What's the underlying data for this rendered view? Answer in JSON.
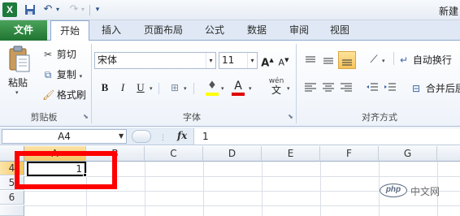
{
  "app": {
    "logo_letter": "X",
    "title": "新建"
  },
  "qat": {
    "save_icon": "save-icon",
    "undo_icon": "undo-icon",
    "redo_icon": "redo-icon",
    "customize_icon": "customize-qat-icon"
  },
  "tabs": [
    {
      "label": "文件"
    },
    {
      "label": "开始"
    },
    {
      "label": "插入"
    },
    {
      "label": "页面布局"
    },
    {
      "label": "公式"
    },
    {
      "label": "数据"
    },
    {
      "label": "审阅"
    },
    {
      "label": "视图"
    }
  ],
  "clipboard": {
    "paste_label": "粘贴",
    "cut_label": "剪切",
    "copy_label": "复制",
    "format_painter_label": "格式刷",
    "group_label": "剪贴板"
  },
  "font": {
    "font_name": "宋体",
    "font_size": "11",
    "bold_label": "B",
    "italic_label": "I",
    "underline_label": "U",
    "grow_label": "A",
    "shrink_label": "A",
    "font_color_label": "A",
    "wen_label": "wén",
    "wen_char": "文",
    "group_label": "字体"
  },
  "alignment": {
    "wrap_text_label": "自动换行",
    "merge_center_label": "合并后居",
    "group_label": "对齐方式"
  },
  "formula_bar": {
    "name_box": "A4",
    "fx_label": "fx",
    "content": "1"
  },
  "sheet": {
    "columns": [
      "A",
      "B",
      "C",
      "D",
      "E",
      "F",
      "G"
    ],
    "rows": [
      "4",
      "5",
      "6"
    ],
    "active_cell_value": "1"
  },
  "watermark": {
    "logo_text": "php",
    "text": "中文网"
  },
  "colors": {
    "file_tab": "#1f7431",
    "highlight": "#ff0000",
    "selected_header": "#f4c562"
  }
}
